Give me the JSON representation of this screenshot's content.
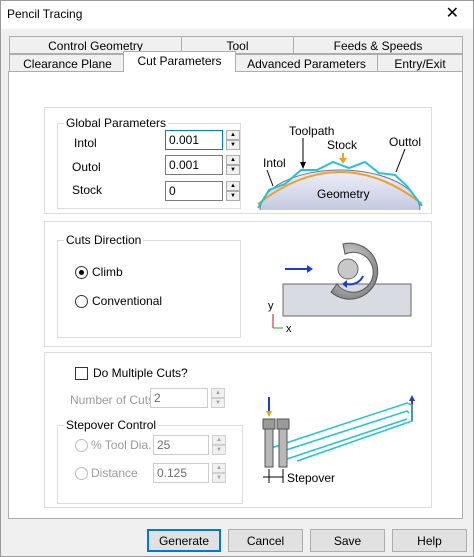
{
  "window": {
    "title": "Pencil Tracing"
  },
  "tabs_row1": [
    {
      "label": "Control Geometry"
    },
    {
      "label": "Tool"
    },
    {
      "label": "Feeds & Speeds"
    }
  ],
  "tabs_row2": [
    {
      "label": "Clearance Plane"
    },
    {
      "label": "Cut Parameters",
      "active": true
    },
    {
      "label": "Advanced Parameters"
    },
    {
      "label": "Entry/Exit"
    }
  ],
  "global_params": {
    "group_label": "Global Parameters",
    "intol_label": "Intol",
    "intol_value": "0.001",
    "outol_label": "Outol",
    "outol_value": "0.001",
    "stock_label": "Stock",
    "stock_value": "0"
  },
  "diagram_global": {
    "toolpath": "Toolpath",
    "stock": "Stock",
    "outtol": "Outtol",
    "intol": "Intol",
    "geometry": "Geometry"
  },
  "cuts_direction": {
    "group_label": "Cuts Direction",
    "climb_label": "Climb",
    "conventional_label": "Conventional",
    "selected": "climb"
  },
  "diagram_cut": {
    "axis_y": "y",
    "axis_x": "x"
  },
  "multiple_cuts": {
    "checkbox_label": "Do Multiple Cuts?",
    "checked": false,
    "num_cuts_label": "Number of Cuts",
    "num_cuts_value": "2"
  },
  "stepover_control": {
    "group_label": "Stepover Control",
    "pct_label": "% Tool Dia.",
    "pct_value": "25",
    "distance_label": "Distance",
    "distance_value": "0.125"
  },
  "diagram_stepover": {
    "label": "Stepover"
  },
  "buttons": {
    "generate": "Generate",
    "cancel": "Cancel",
    "save": "Save",
    "help": "Help"
  },
  "colors": {
    "toolpath_cyan": "#21c4d6",
    "stock_orange": "#f0a030",
    "axis_blue": "#1a3fd0",
    "axis_red": "#cc1111",
    "accent_blue": "#0078d7"
  }
}
